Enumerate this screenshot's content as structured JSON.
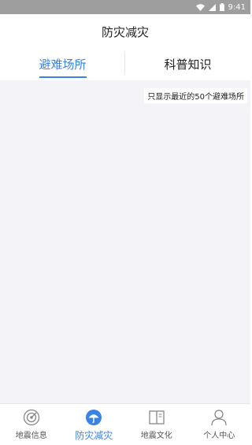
{
  "status_bar": {
    "time": "9:41",
    "icons": [
      "wifi-icon",
      "signal-icon",
      "battery-icon"
    ]
  },
  "header": {
    "title": "防灾减灾"
  },
  "tabs": [
    {
      "label": "避难场所",
      "active": true
    },
    {
      "label": "科普知识",
      "active": false
    }
  ],
  "content": {
    "notice": "只显示最近的50个避难场所"
  },
  "bottom_nav": [
    {
      "label": "地震信息",
      "icon": "radar-icon",
      "active": false
    },
    {
      "label": "防灾减灾",
      "icon": "umbrella-icon",
      "active": true
    },
    {
      "label": "地震文化",
      "icon": "book-icon",
      "active": false
    },
    {
      "label": "个人中心",
      "icon": "person-icon",
      "active": false
    }
  ],
  "colors": {
    "accent": "#3b82e6",
    "status_bar": "#9e9e9e",
    "content_bg": "#f4f3f8"
  }
}
